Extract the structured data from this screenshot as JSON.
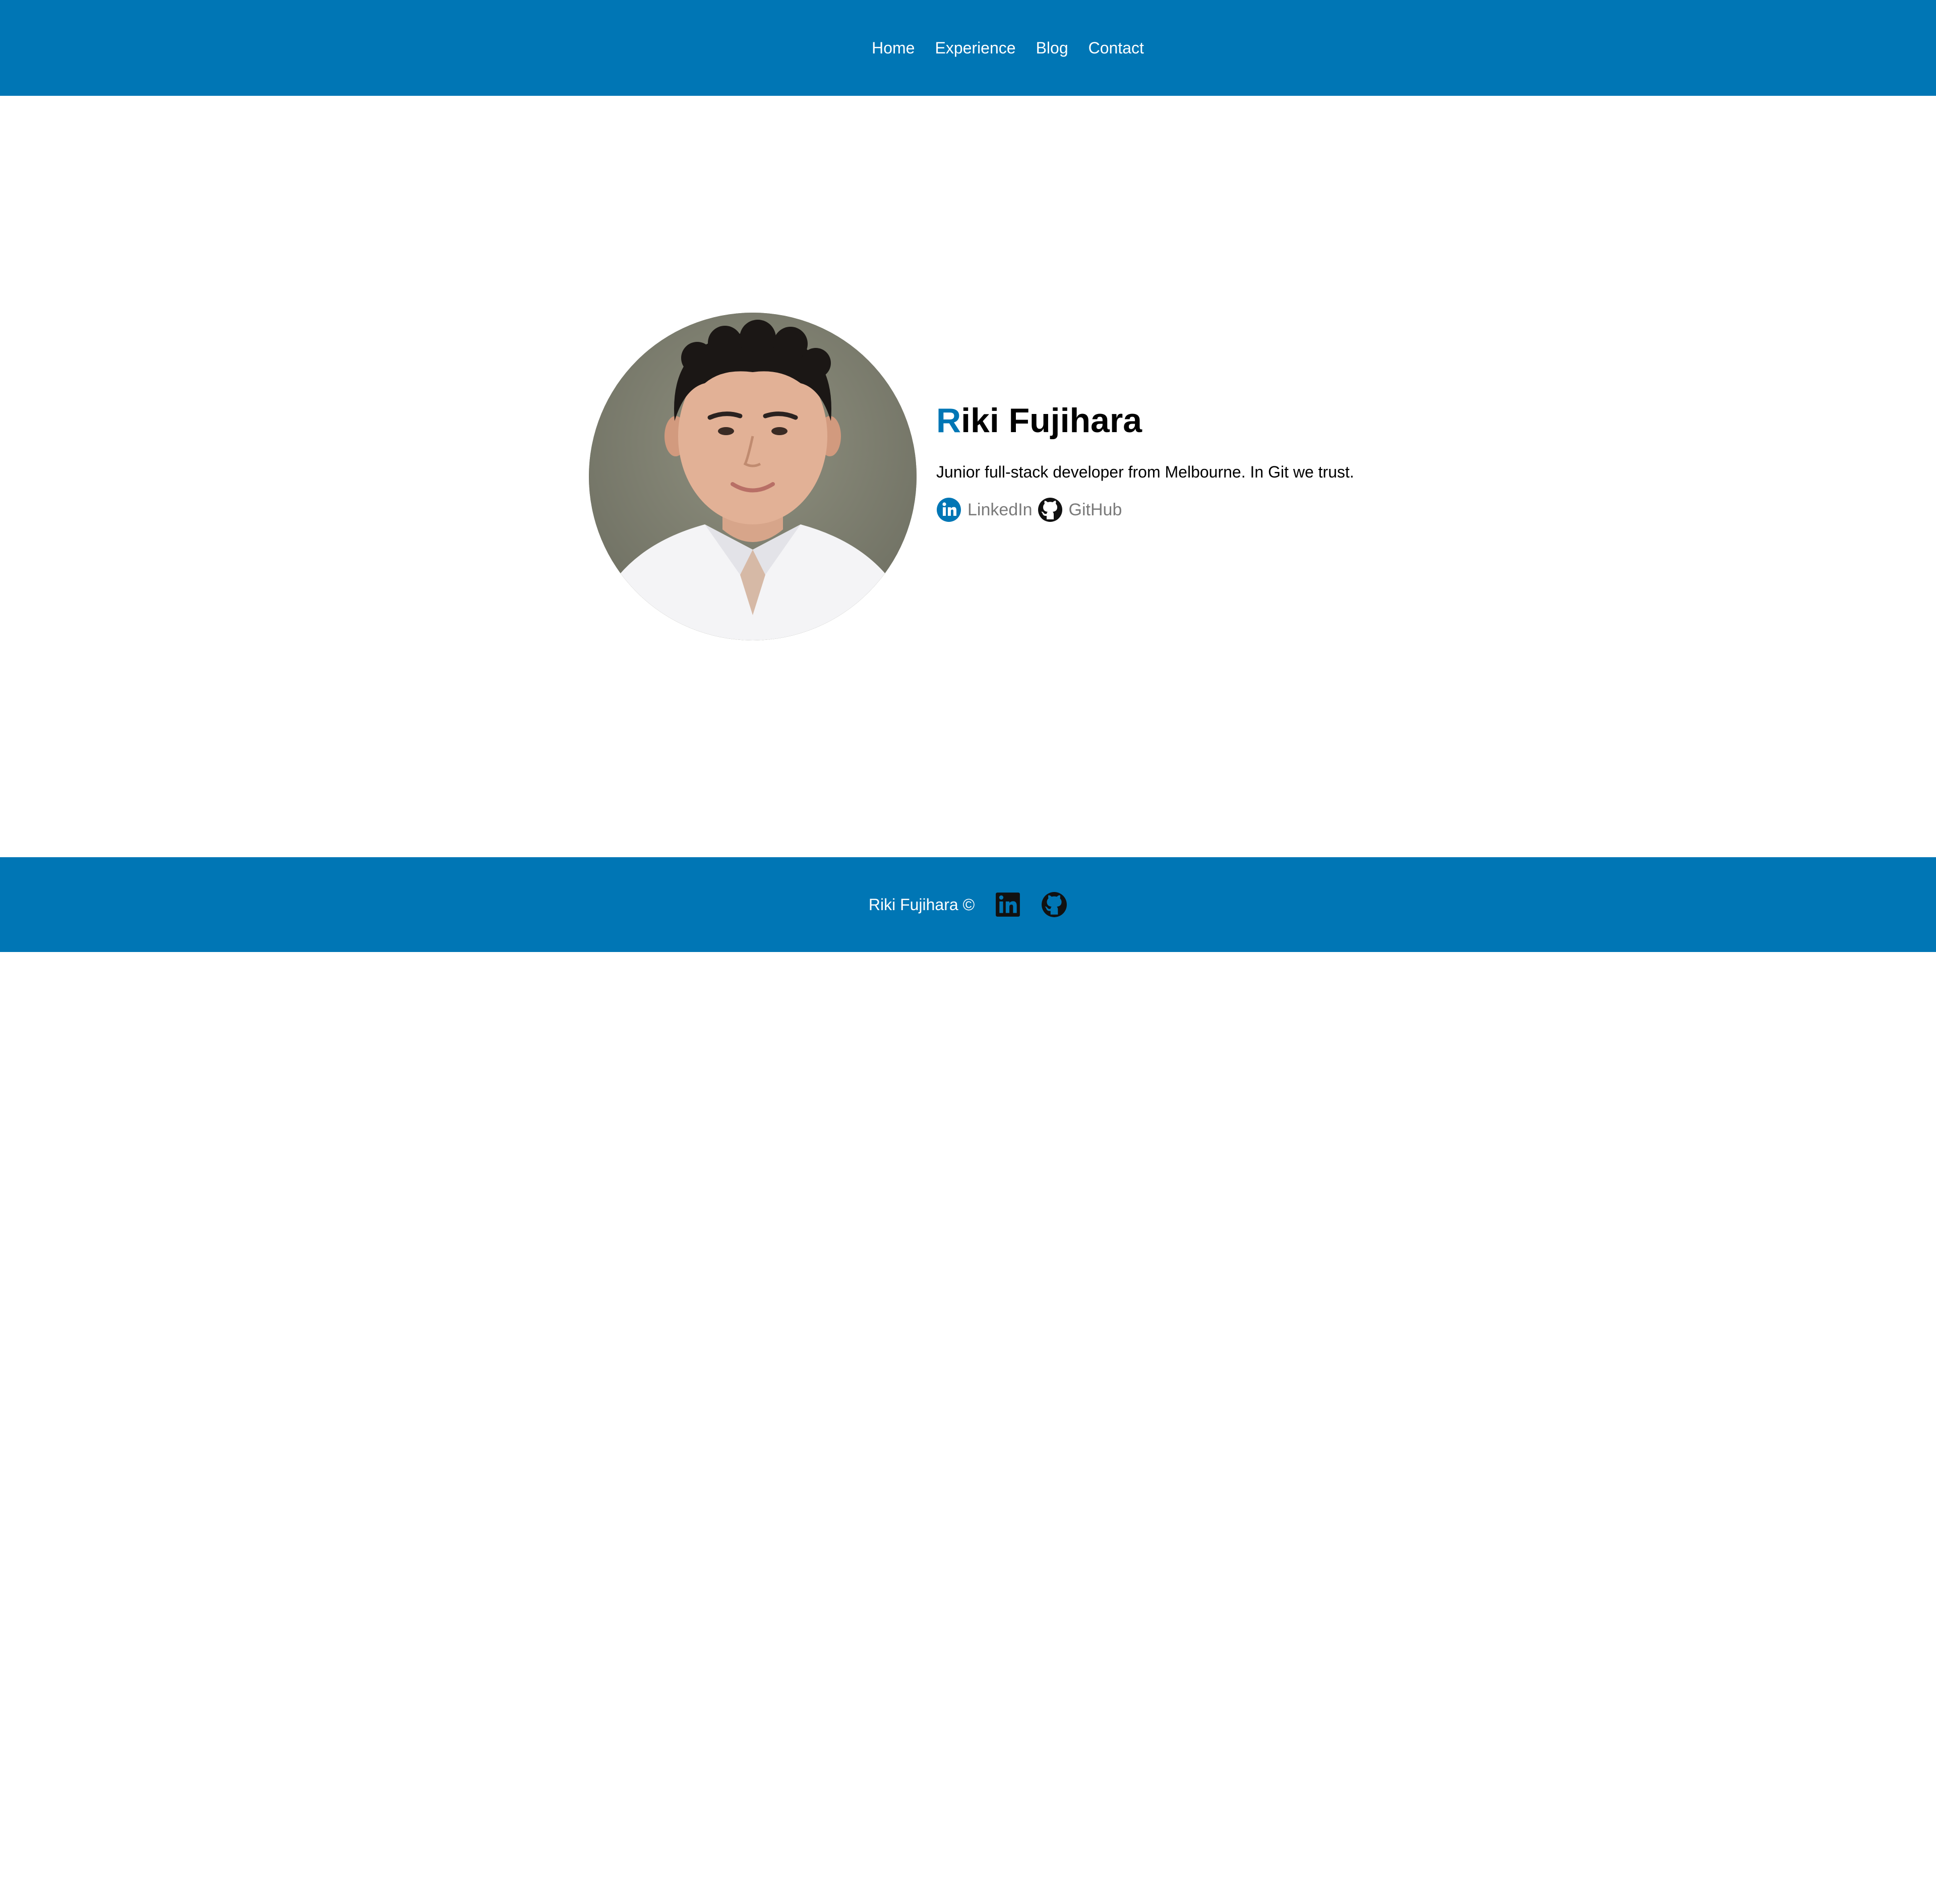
{
  "nav": {
    "items": [
      {
        "label": "Home"
      },
      {
        "label": "Experience"
      },
      {
        "label": "Blog"
      },
      {
        "label": "Contact"
      }
    ]
  },
  "hero": {
    "name_first_letter": "R",
    "name_rest": "iki Fujihara",
    "tagline": "Junior full-stack developer from Melbourne. In Git we trust.",
    "links": [
      {
        "label": "LinkedIn",
        "icon": "linkedin-icon"
      },
      {
        "label": "GitHub",
        "icon": "github-icon"
      }
    ]
  },
  "footer": {
    "text": "Riki Fujihara ©",
    "icons": [
      "linkedin-icon",
      "github-icon"
    ]
  },
  "colors": {
    "brand": "#0076b5",
    "text": "#000000",
    "muted": "#7a7a7a",
    "background": "#ffffff"
  }
}
